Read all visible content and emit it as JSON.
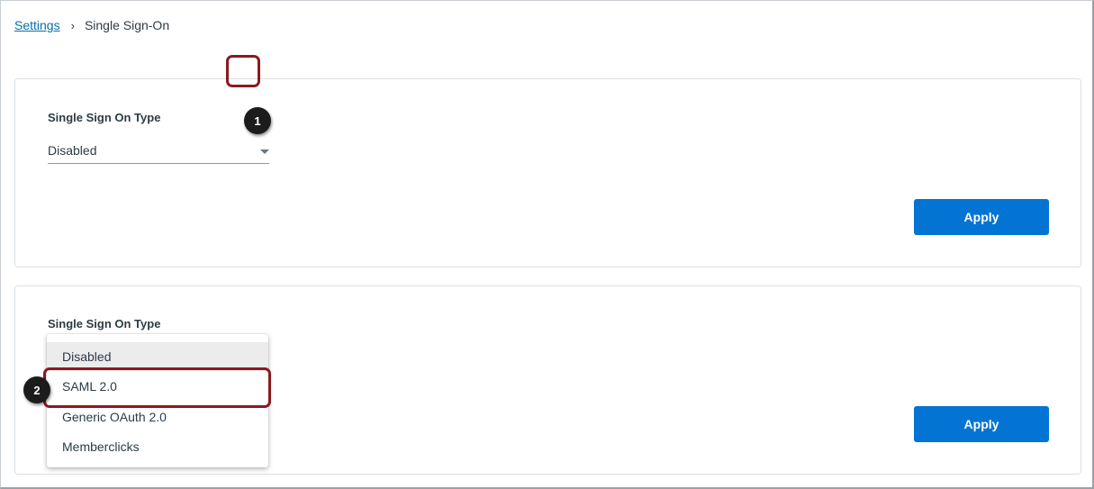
{
  "breadcrumb": {
    "parent": "Settings",
    "separator": "›",
    "current": "Single Sign-On"
  },
  "cards": [
    {
      "field_label": "Single Sign On Type",
      "select_value": "Disabled",
      "apply_label": "Apply"
    },
    {
      "field_label": "Single Sign On Type",
      "apply_label": "Apply"
    }
  ],
  "dropdown": {
    "options": [
      "Disabled",
      "SAML 2.0",
      "Generic OAuth 2.0",
      "Memberclicks"
    ],
    "selected": "Disabled",
    "highlighted": "SAML 2.0"
  },
  "callouts": [
    "1",
    "2"
  ],
  "colors": {
    "link": "#0770a3",
    "button": "#0374d4",
    "highlight_border": "#8a1a1f",
    "callout": "#1c1c1c"
  }
}
